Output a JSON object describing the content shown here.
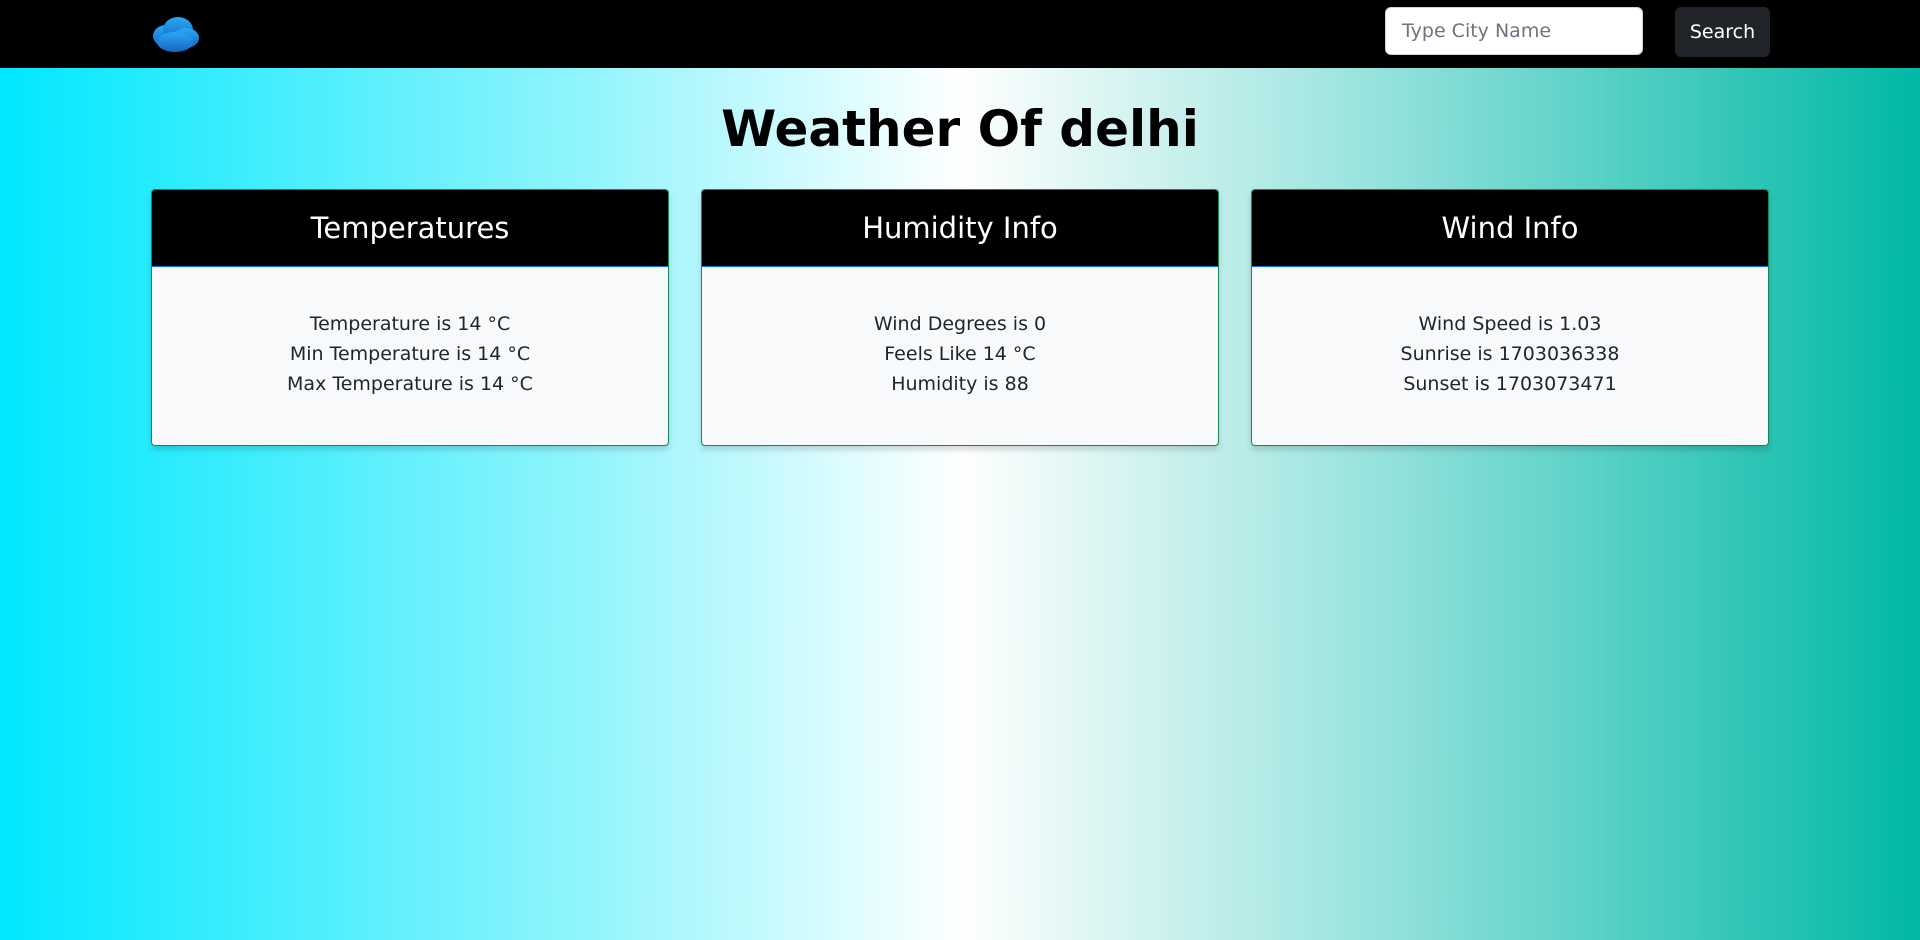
{
  "navbar": {
    "logo_icon": "cloud-icon",
    "logo_color": "#1e88e5",
    "search": {
      "placeholder": "Type City Name",
      "value": ""
    },
    "search_button_label": "Search"
  },
  "page": {
    "title": "Weather Of delhi"
  },
  "cards": [
    {
      "title": "Temperatures",
      "lines": [
        "Temperature is 14 °C",
        "Min Temperature is 14 °C",
        "Max Temperature is 14 °C"
      ]
    },
    {
      "title": "Humidity Info",
      "lines": [
        "Wind Degrees is 0",
        "Feels Like 14 °C",
        "Humidity is 88"
      ]
    },
    {
      "title": "Wind Info",
      "lines": [
        "Wind Speed is 1.03",
        "Sunrise is 1703036338",
        "Sunset is 1703073471"
      ]
    }
  ],
  "colors": {
    "navbar_bg": "#000000",
    "gradient": [
      "#00e8ff",
      "#ffffff",
      "#00b8a5"
    ],
    "card_border": "#198754",
    "card_header_bg": "#000000"
  }
}
